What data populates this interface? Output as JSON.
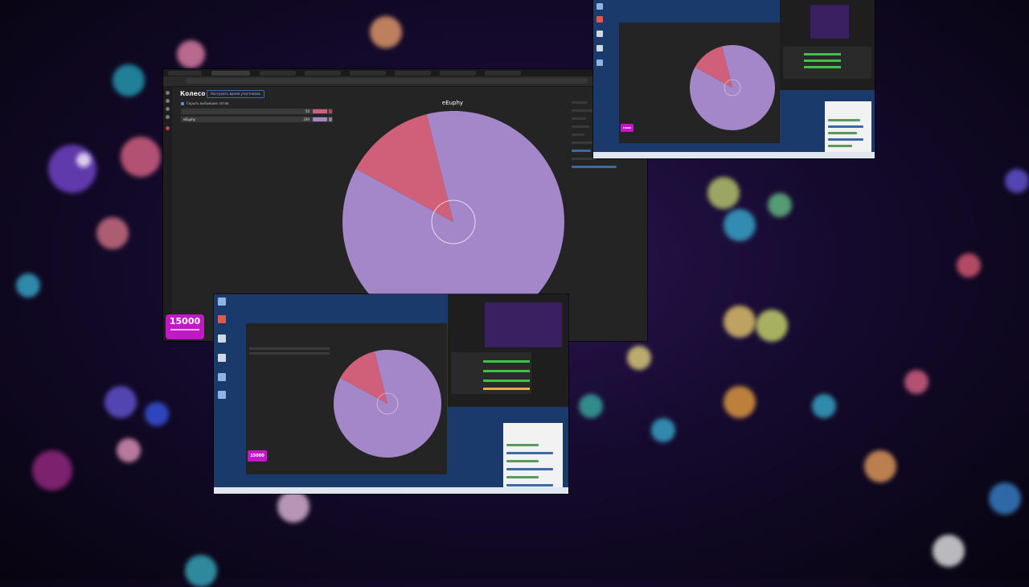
{
  "page": {
    "title": "Колесо",
    "time_button": "Настроить время участников",
    "hide_eliminated": "Скрыть выбывших лотов",
    "winner": "eEuphy",
    "promo_number": "15000"
  },
  "wheel": {
    "lots": [
      {
        "name": "eEuphy",
        "value": 330,
        "color": "#a487c8"
      },
      {
        "name": "",
        "value": 50,
        "color": "#d0607a"
      }
    ]
  },
  "colors": {
    "wheel_main": "#a487c8",
    "wheel_minor": "#d0607a",
    "promo": "#c218c8",
    "page_bg": "#242424"
  }
}
